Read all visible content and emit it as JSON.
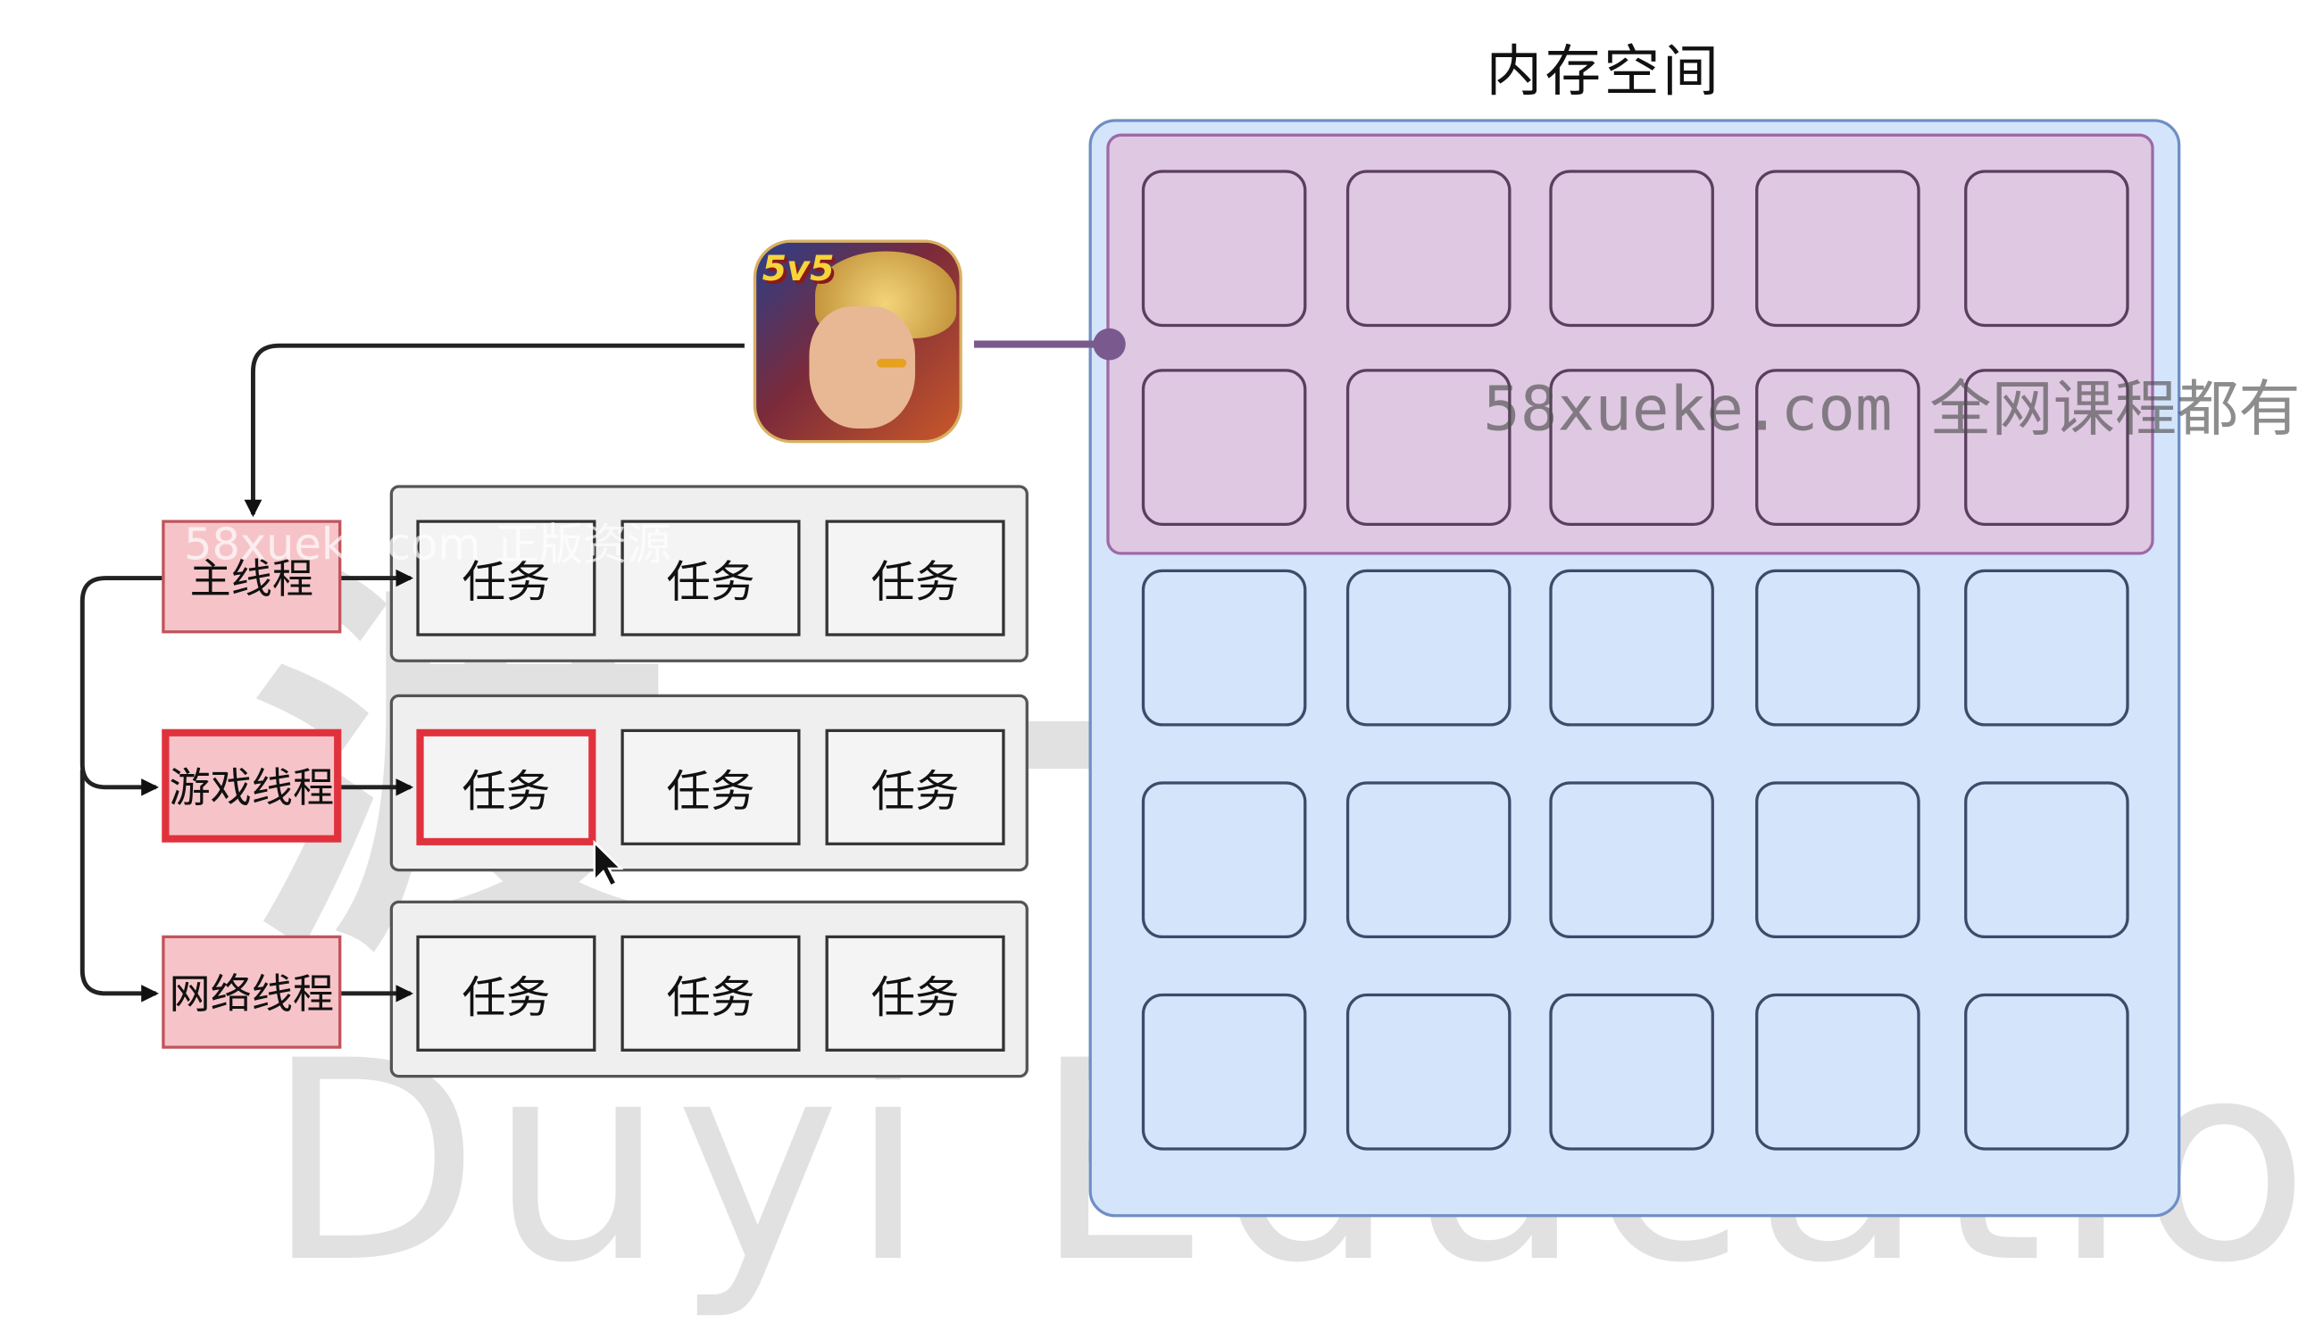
{
  "title": "内存空间",
  "threads": [
    {
      "label": "主线程",
      "tasks": [
        "任务",
        "任务",
        "任务"
      ]
    },
    {
      "label": "游戏线程",
      "tasks": [
        "任务",
        "任务",
        "任务"
      ]
    },
    {
      "label": "网络线程",
      "tasks": [
        "任务",
        "任务",
        "任务"
      ]
    }
  ],
  "app_icon": {
    "badge": "5v5",
    "icon": "game-app-icon"
  },
  "watermarks": {
    "url": "58xueke.com 全网课程都有",
    "small": "58xueke.com 正版资源",
    "brand_cn": "渡一教育",
    "brand_en": "Duyi Education"
  },
  "colors": {
    "memory_fill": "#d4e4fb",
    "memory_region": "#dfc8e2",
    "thread_fill": "#f6c4c8",
    "highlight": "#e0323d",
    "connector": "#7a5a8e"
  }
}
